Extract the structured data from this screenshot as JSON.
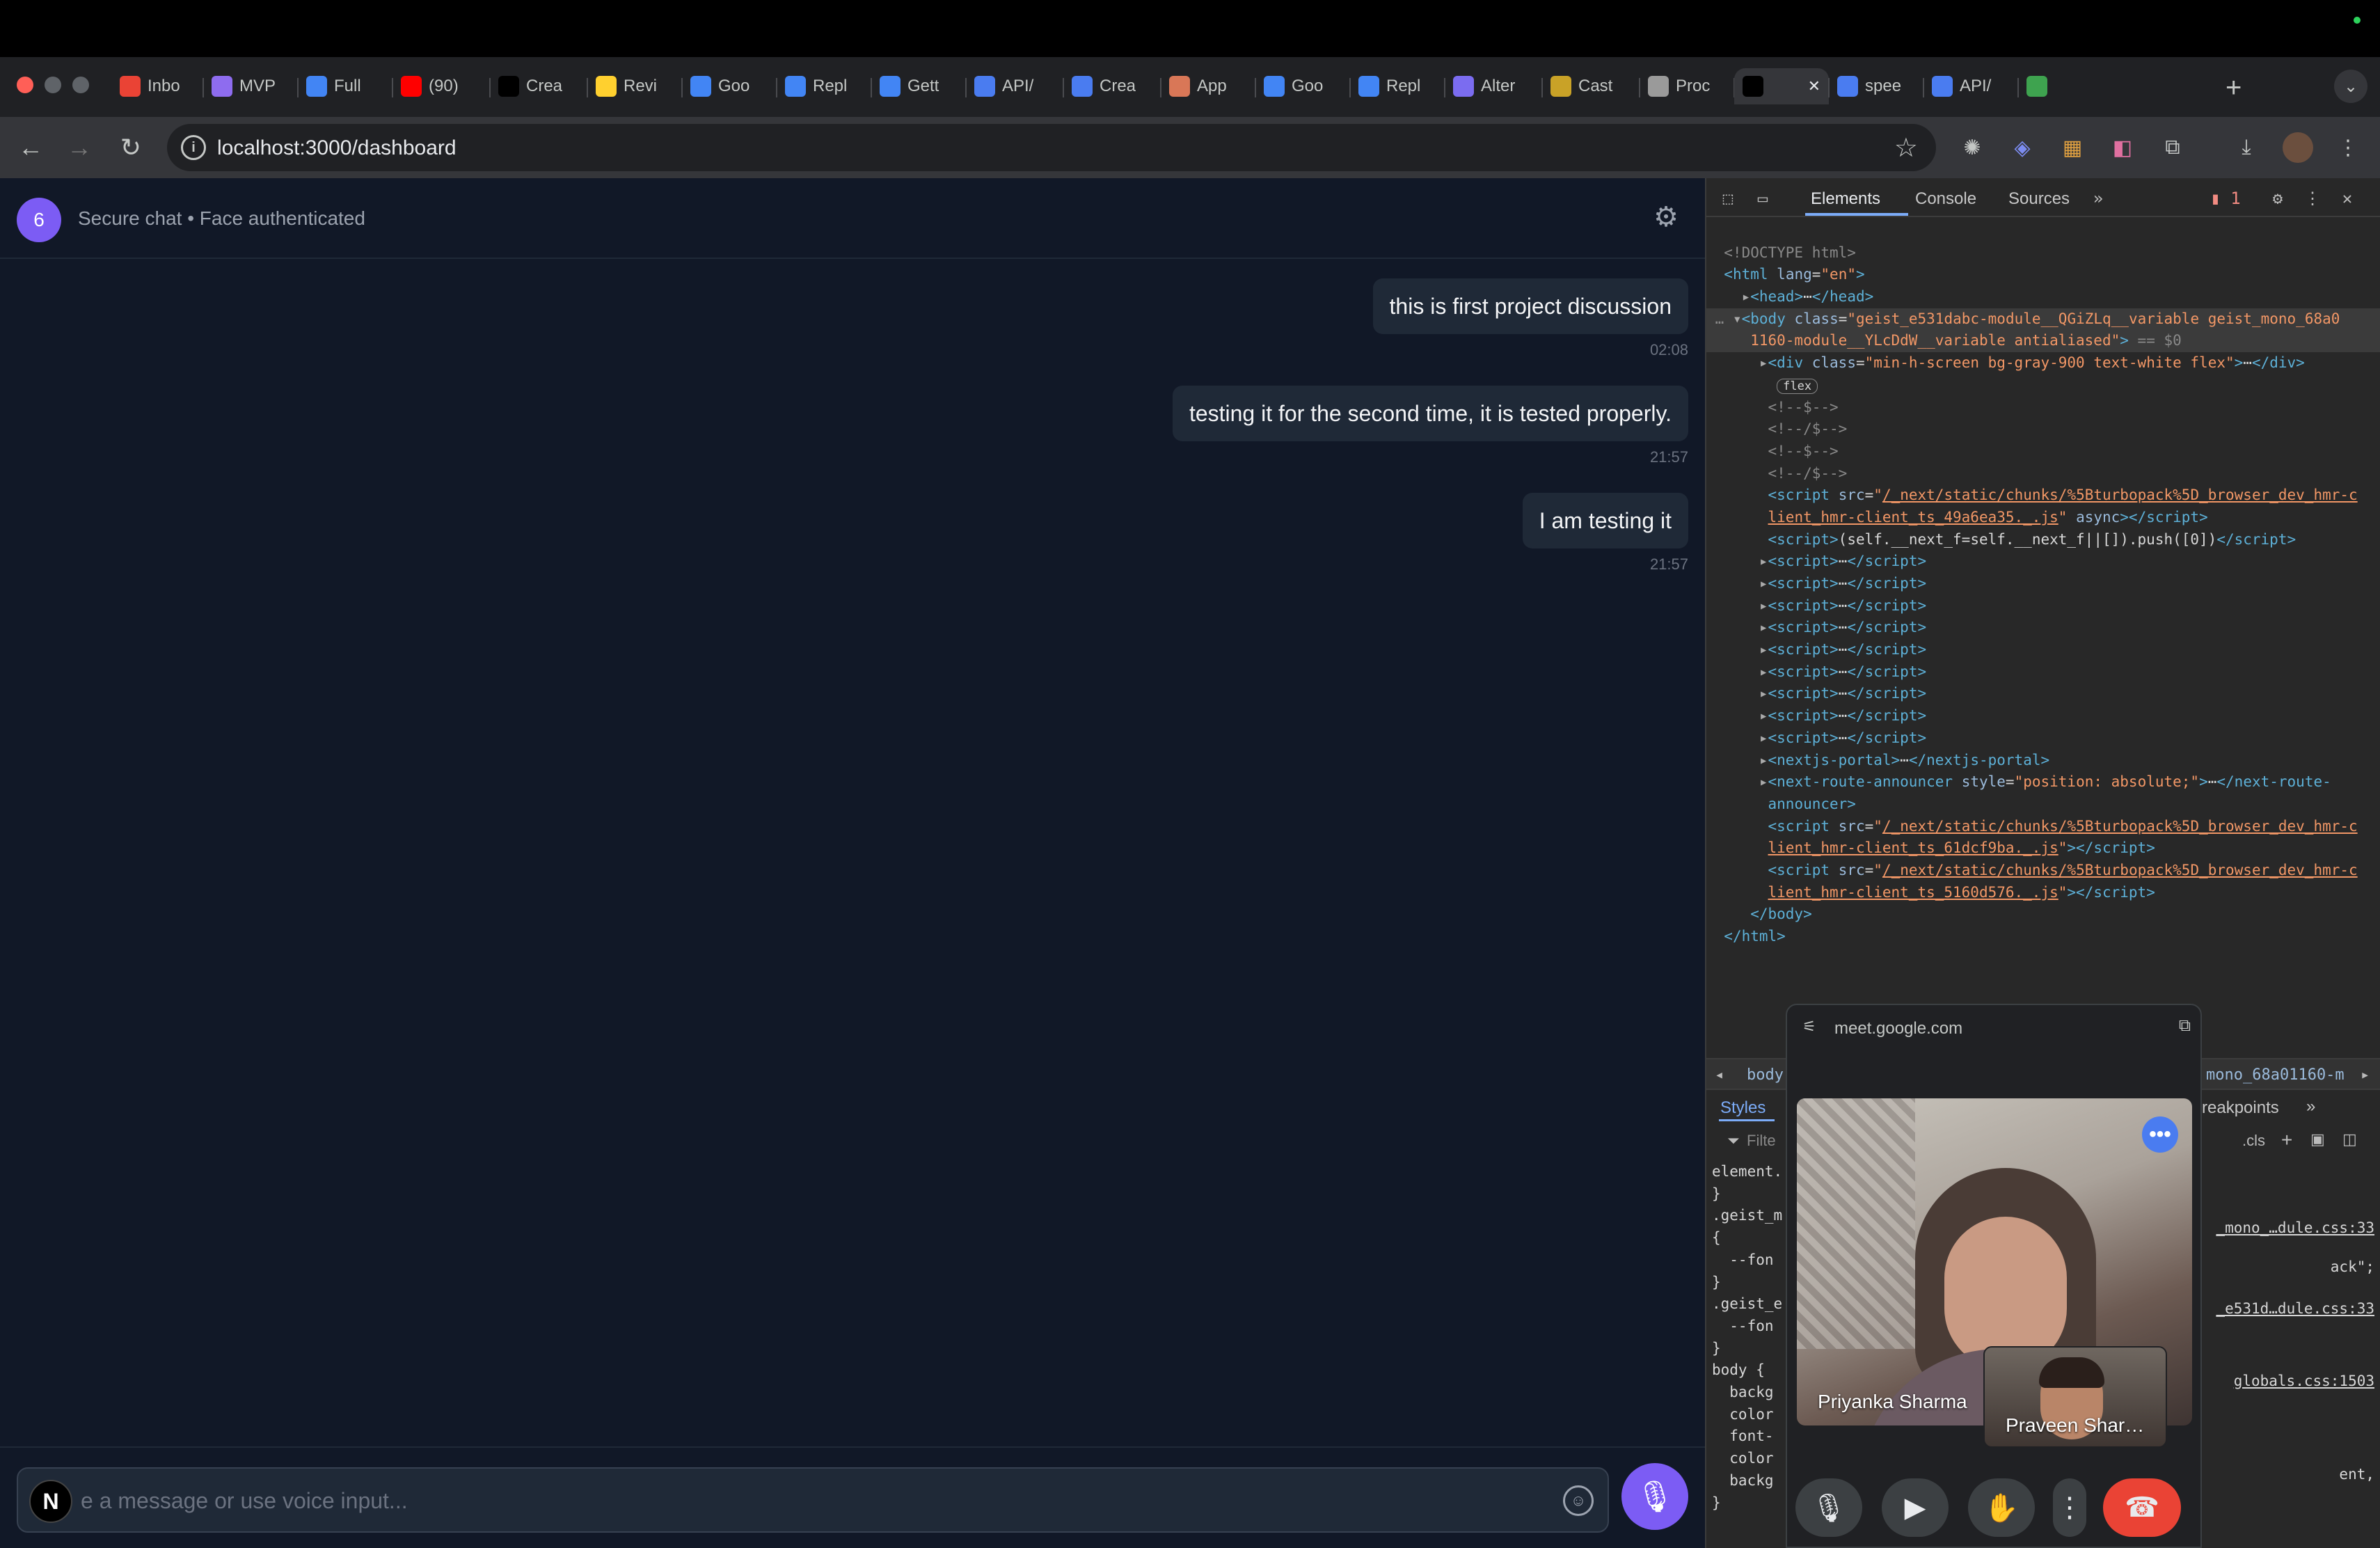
{
  "browser": {
    "tabs": [
      {
        "label": "Inbo",
        "icon": "gmail-icon",
        "color": "#ea4335"
      },
      {
        "label": "MVP",
        "icon": "app-icon",
        "color": "#8e6cef"
      },
      {
        "label": "Full",
        "icon": "docs-icon",
        "color": "#4285f4"
      },
      {
        "label": "(90)",
        "icon": "youtube-icon",
        "color": "#ff0000"
      },
      {
        "label": "Crea",
        "icon": "vercel-icon",
        "color": "#000000"
      },
      {
        "label": "Revi",
        "icon": "miro-icon",
        "color": "#ffd02f"
      },
      {
        "label": "Goo",
        "icon": "google-icon",
        "color": "#4285f4"
      },
      {
        "label": "Repl",
        "icon": "google-icon",
        "color": "#4285f4"
      },
      {
        "label": "Gett",
        "icon": "google-icon",
        "color": "#4285f4"
      },
      {
        "label": "API/",
        "icon": "api-icon",
        "color": "#4a7cf0"
      },
      {
        "label": "Crea",
        "icon": "app-icon",
        "color": "#4a7cf0"
      },
      {
        "label": "App",
        "icon": "claude-icon",
        "color": "#d97757"
      },
      {
        "label": "Goo",
        "icon": "google-icon",
        "color": "#4285f4"
      },
      {
        "label": "Repl",
        "icon": "google-icon",
        "color": "#4285f4"
      },
      {
        "label": "Alter",
        "icon": "app-icon",
        "color": "#7b6cf0"
      },
      {
        "label": "Cast",
        "icon": "app-icon",
        "color": "#c9a227"
      },
      {
        "label": "Proc",
        "icon": "chatgpt-icon",
        "color": "#9a9a9a"
      },
      {
        "label": "",
        "icon": "vercel-icon",
        "color": "#000000",
        "active": true
      },
      {
        "label": "spee",
        "icon": "shield-icon",
        "color": "#4a7cf0"
      },
      {
        "label": "API/",
        "icon": "api-icon",
        "color": "#4a7cf0"
      },
      {
        "label": "",
        "icon": "app-icon",
        "color": "#3ea34f"
      }
    ],
    "url": "localhost:3000/dashboard"
  },
  "chat": {
    "header": {
      "badge": "6",
      "title": "Secure chat • Face authenticated"
    },
    "messages": [
      {
        "text": "this is first project discussion",
        "time": "02:08"
      },
      {
        "text": "testing it for the second time, it is tested properly.",
        "time": "21:57"
      },
      {
        "text": "I am testing it",
        "time": "21:57"
      }
    ],
    "composer": {
      "badge": "N",
      "placeholder": "e a message or use voice input..."
    }
  },
  "devtools": {
    "tabs": [
      "Elements",
      "Console",
      "Sources"
    ],
    "issues_count": "1",
    "breadcrumb_left": "body",
    "breadcrumb_right": "mono_68a01160-m",
    "subtabs": {
      "styles": "Styles",
      "breakpoints": "reakpoints",
      "filter": "Filte",
      "cls": ".cls"
    },
    "styles_lines": [
      "element.",
      "}",
      ".geist_m",
      "{",
      "  --fon",
      "}",
      ".geist_e",
      "  --fon",
      "}",
      "body {",
      "  backg",
      "  color",
      "  font-",
      "  color",
      "  backg",
      "}"
    ],
    "styles_right": [
      {
        "text": "_mono_…dule.css:33",
        "link": true
      },
      {
        "text": "ack\";",
        "link": false
      },
      {
        "text": "_e531d…dule.css:33",
        "link": true
      },
      {
        "text": "globals.css:1503",
        "link": true
      },
      {
        "text": "ent,",
        "link": false
      }
    ]
  },
  "meet_pip": {
    "url": "meet.google.com",
    "participant_main": "Priyanka Sharma",
    "participant_self": "Praveen Shar…"
  },
  "colors": {
    "accent": "#7c5cf4",
    "chat_bg": "#111827",
    "end_call": "#ea4335"
  }
}
